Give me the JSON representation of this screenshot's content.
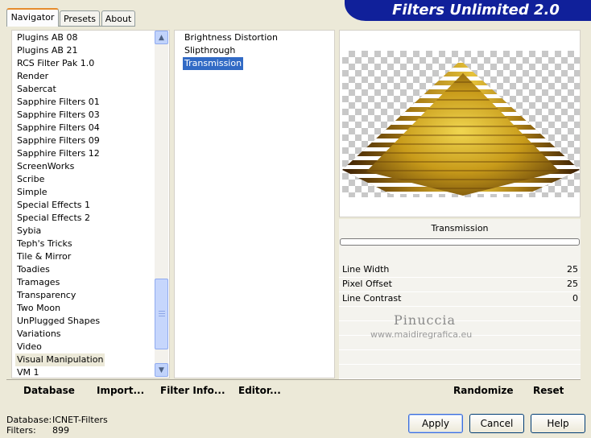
{
  "tabs": [
    {
      "label": "Navigator",
      "active": true
    },
    {
      "label": "Presets",
      "active": false
    },
    {
      "label": "About",
      "active": false
    }
  ],
  "title": "Filters Unlimited 2.0",
  "categories": [
    "Plugins AB 08",
    "Plugins AB 21",
    "RCS Filter Pak 1.0",
    "Render",
    "Sabercat",
    "Sapphire Filters 01",
    "Sapphire Filters 03",
    "Sapphire Filters 04",
    "Sapphire Filters 09",
    "Sapphire Filters 12",
    "ScreenWorks",
    "Scribe",
    "Simple",
    "Special Effects 1",
    "Special Effects 2",
    "Sybia",
    "Teph's Tricks",
    "Tile & Mirror",
    "Toadies",
    "Tramages",
    "Transparency",
    "Two Moon",
    "UnPlugged Shapes",
    "Variations",
    "Video",
    "Visual Manipulation",
    "VM 1"
  ],
  "selected_category": "Visual Manipulation",
  "filters": [
    "Brightness Distortion",
    "Slipthrough",
    "Transmission"
  ],
  "selected_filter": "Transmission",
  "filter_name": "Transmission",
  "params": [
    {
      "label": "Line Width",
      "value": "25"
    },
    {
      "label": "Pixel Offset",
      "value": "25"
    },
    {
      "label": "Line Contrast",
      "value": "0"
    }
  ],
  "watermark": {
    "name": "Pinuccia",
    "url": "www.maidiregrafica.eu"
  },
  "toolbar": {
    "database": "Database",
    "import": "Import...",
    "filter_info": "Filter Info...",
    "editor": "Editor...",
    "randomize": "Randomize",
    "reset": "Reset"
  },
  "status": {
    "database_label": "Database:",
    "database_value": "ICNET-Filters",
    "filters_label": "Filters:",
    "filters_value": "899"
  },
  "buttons": {
    "apply": "Apply",
    "cancel": "Cancel",
    "help": "Help"
  },
  "colors": {
    "title_bg": "#10209a",
    "selection": "#316ac5",
    "gold": "#c89b1a"
  },
  "icons": {
    "scroll_up": "chevron-up-icon",
    "scroll_down": "chevron-down-icon"
  }
}
